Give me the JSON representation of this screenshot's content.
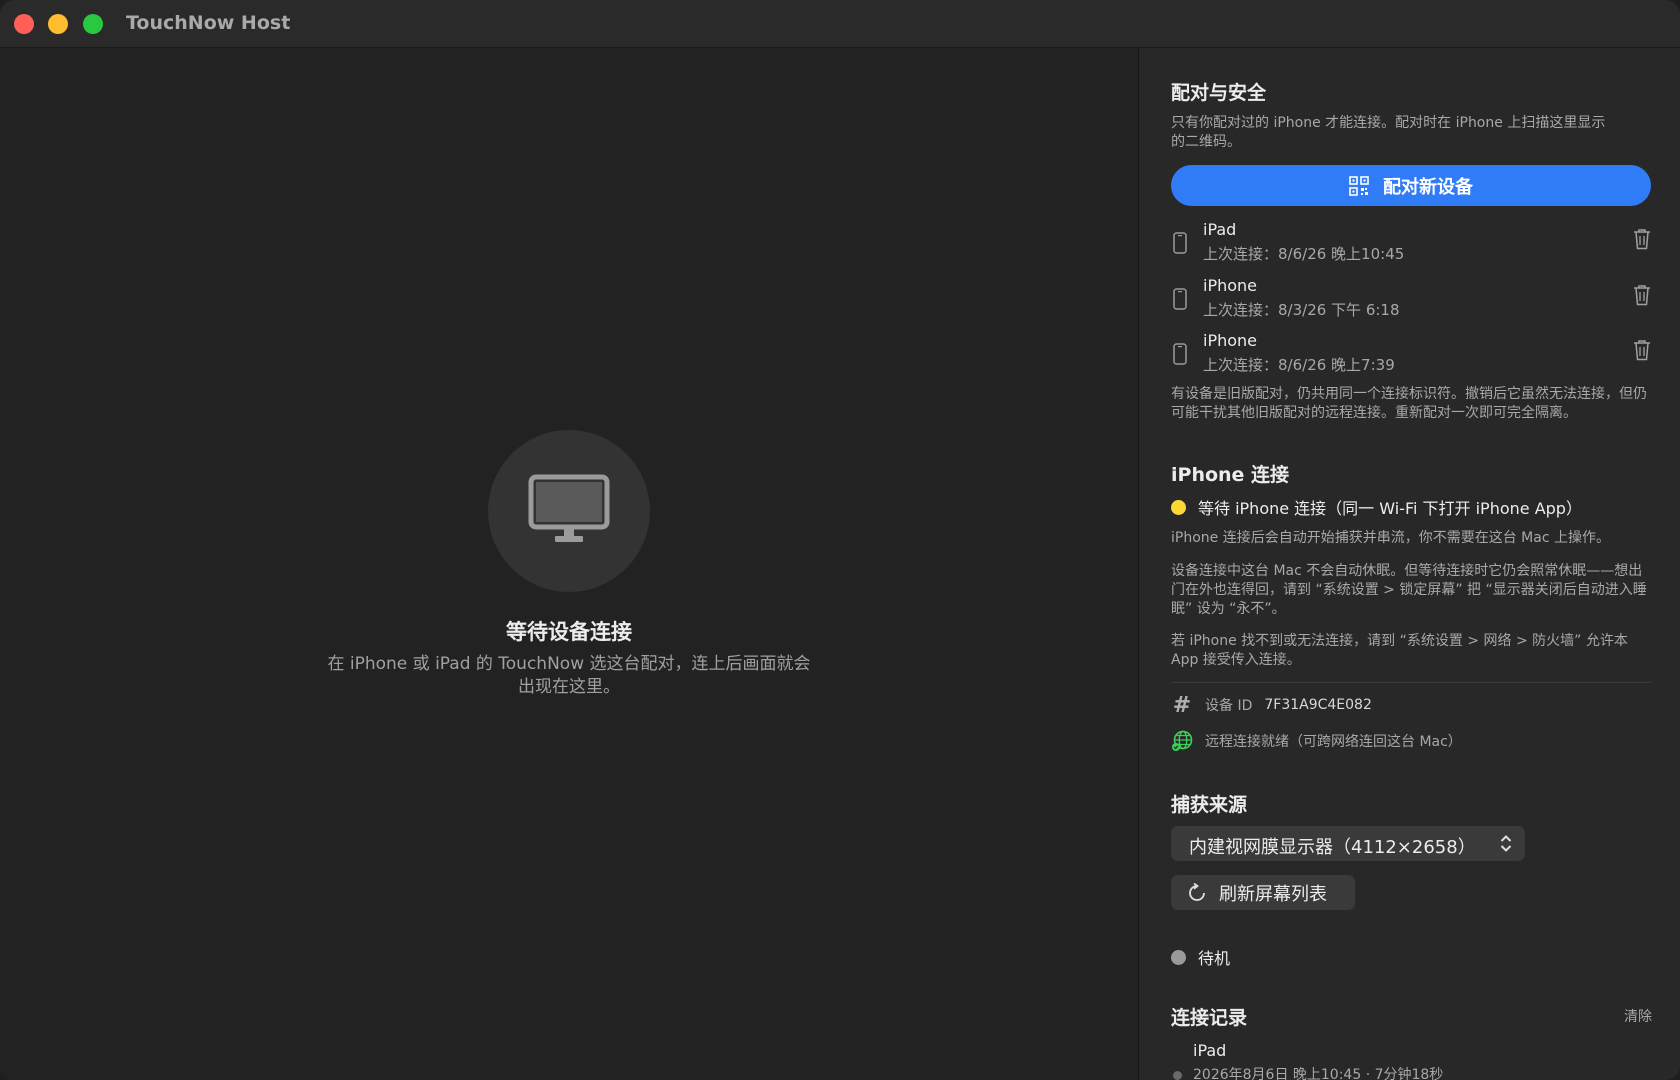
{
  "window": {
    "title": "TouchNow Host"
  },
  "main": {
    "waiting_title": "等待设备连接",
    "waiting_desc": "在 iPhone 或 iPad 的 TouchNow 选这台配对，连上后画面就会出现在这里。",
    "icon": "monitor-icon"
  },
  "pairing": {
    "title": "配对与安全",
    "note": "只有你配对过的 iPhone 才能连接。配对时在 iPhone 上扫描这里显示的二维码。",
    "pair_button": "配对新设备",
    "devices": [
      {
        "name": "iPad",
        "last": "上次连接：8/6/26 晚上10:45"
      },
      {
        "name": "iPhone",
        "last": "上次连接：8/3/26 下午 6:18"
      },
      {
        "name": "iPhone",
        "last": "上次连接：8/6/26 晚上7:39"
      }
    ],
    "legacy_note": "有设备是旧版配对，仍共用同一个连接标识符。撤销后它虽然无法连接，但仍可能干扰其他旧版配对的远程连接。重新配对一次即可完全隔离。"
  },
  "iphone": {
    "title": "iPhone 连接",
    "status": "等待 iPhone 连接（同一 Wi-Fi 下打开 iPhone App）",
    "note1": "iPhone 连接后会自动开始捕获并串流，你不需要在这台 Mac 上操作。",
    "note2": "设备连接中这台 Mac 不会自动休眠。但等待连接时它仍会照常休眠——想出门在外也连得回，请到 “系统设置 > 锁定屏幕” 把 “显示器关闭后自动进入睡眠” 设为 “永不”。",
    "note3": "若 iPhone 找不到或无法连接，请到 “系统设置 > 网络 > 防火墙” 允许本 App 接受传入连接。",
    "device_id_label": "设备 ID",
    "device_id": "7F31A9C4E082",
    "remote_status": "远程连接就绪（可跨网络连回这台 Mac）"
  },
  "capture": {
    "title": "捕获来源",
    "selected": "内建视网膜显示器（4112×2658）",
    "refresh_button": "刷新屏幕列表",
    "state": "待机"
  },
  "log": {
    "title": "连接记录",
    "clear": "清除",
    "entries": [
      {
        "name": "iPad",
        "detail": "2026年8月6日 晚上10:45 · 7分钟18秒"
      }
    ]
  },
  "colors": {
    "accent": "#2f7cf6",
    "waiting": "#fdd835",
    "remote_ok": "#3ecf5a",
    "idle": "#9a9a9a"
  }
}
